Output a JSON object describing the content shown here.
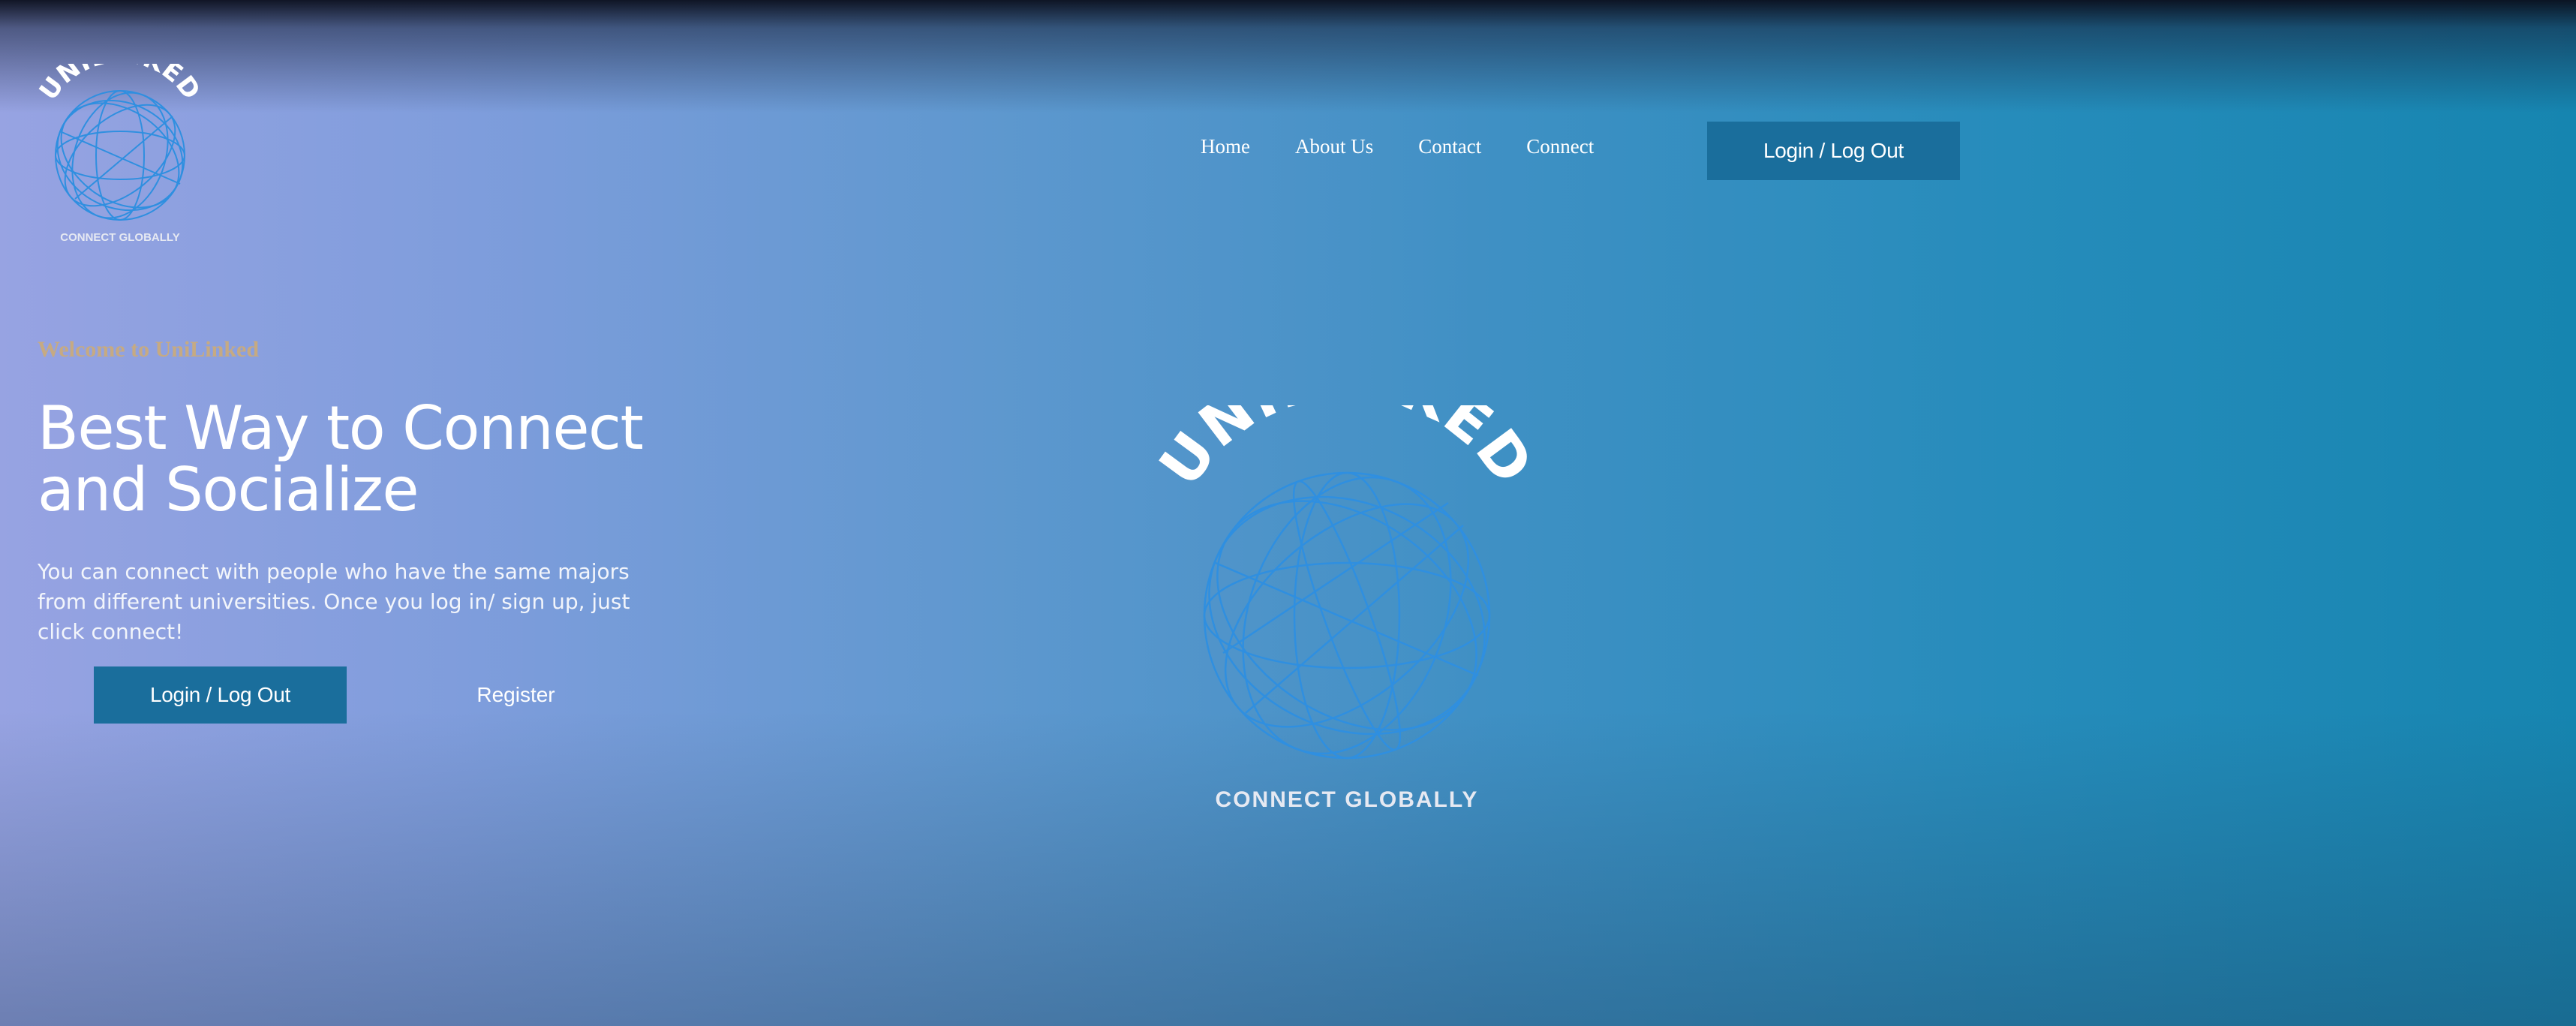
{
  "brand": {
    "name": "UNILINKED",
    "tagline": "CONNECT GLOBALLY"
  },
  "nav": {
    "links": [
      "Home",
      "About Us",
      "Contact",
      "Connect"
    ],
    "login_label": "Login / Log Out"
  },
  "hero": {
    "welcome": "Welcome to UniLinked",
    "title_line1": "Best Way to Connect",
    "title_line2": "and Socialize",
    "description": "You can connect with people who have the same majors from different universities. Once you log in/ sign up, just click connect!",
    "login_label": "Login / Log Out",
    "register_label": "Register"
  },
  "colors": {
    "button_bg": "#1a6e9c",
    "welcome_text": "#c6aa82",
    "globe_line": "#2f8fe0"
  },
  "icons": {
    "logo": "globe-wireframe-icon"
  }
}
